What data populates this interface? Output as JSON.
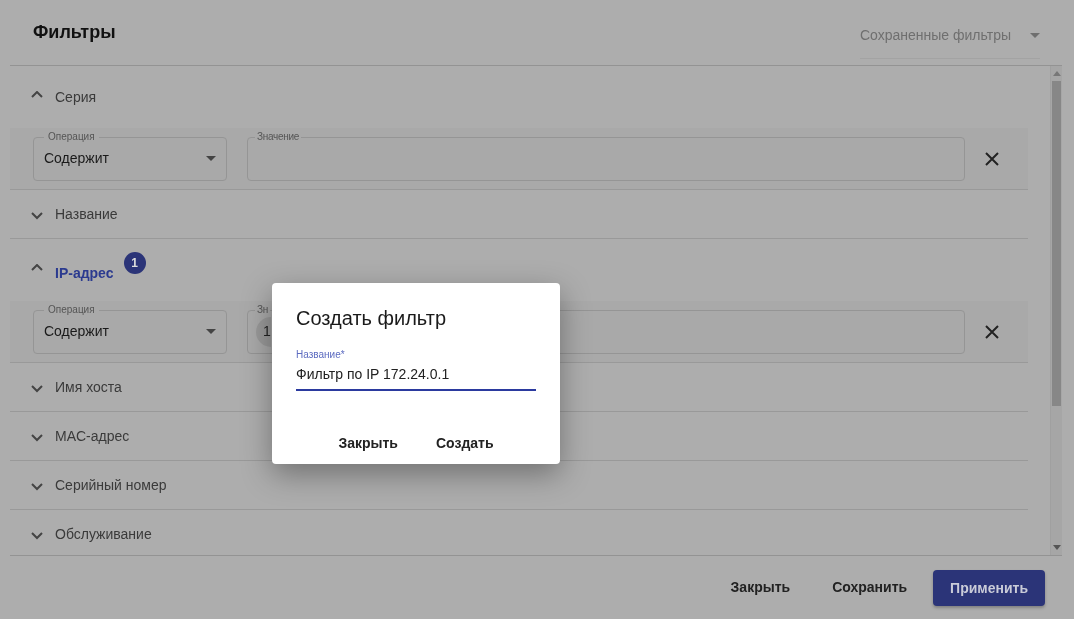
{
  "title": "Фильтры",
  "saved_filters": {
    "placeholder": "Сохраненные фильтры"
  },
  "sections": [
    {
      "label": "Серия",
      "expanded": true,
      "active": false,
      "condition": {
        "operation_label": "Операция",
        "operation": "Содержит",
        "value_label": "Значение"
      }
    },
    {
      "label": "Название",
      "expanded": false,
      "active": false
    },
    {
      "label": "IP-адрес",
      "expanded": true,
      "active": true,
      "badge": "1",
      "condition": {
        "operation_label": "Операция",
        "operation": "Содержит",
        "value_label": "Зн",
        "chip": "1"
      }
    },
    {
      "label": "Имя хоста",
      "expanded": false,
      "active": false
    },
    {
      "label": "MAC-адрес",
      "expanded": false,
      "active": false
    },
    {
      "label": "Серийный номер",
      "expanded": false,
      "active": false
    },
    {
      "label": "Обслуживание",
      "expanded": false,
      "active": false
    }
  ],
  "footer_buttons": [
    {
      "label": "Закрыть",
      "kind": "text"
    },
    {
      "label": "Сохранить",
      "kind": "text"
    },
    {
      "label": "Применить",
      "kind": "primary"
    }
  ],
  "dialog": {
    "title": "Создать фильтр",
    "field_label": "Название*",
    "value": "Фильтр по IP 172.24.0.1",
    "buttons": [
      "Закрыть",
      "Создать"
    ]
  }
}
